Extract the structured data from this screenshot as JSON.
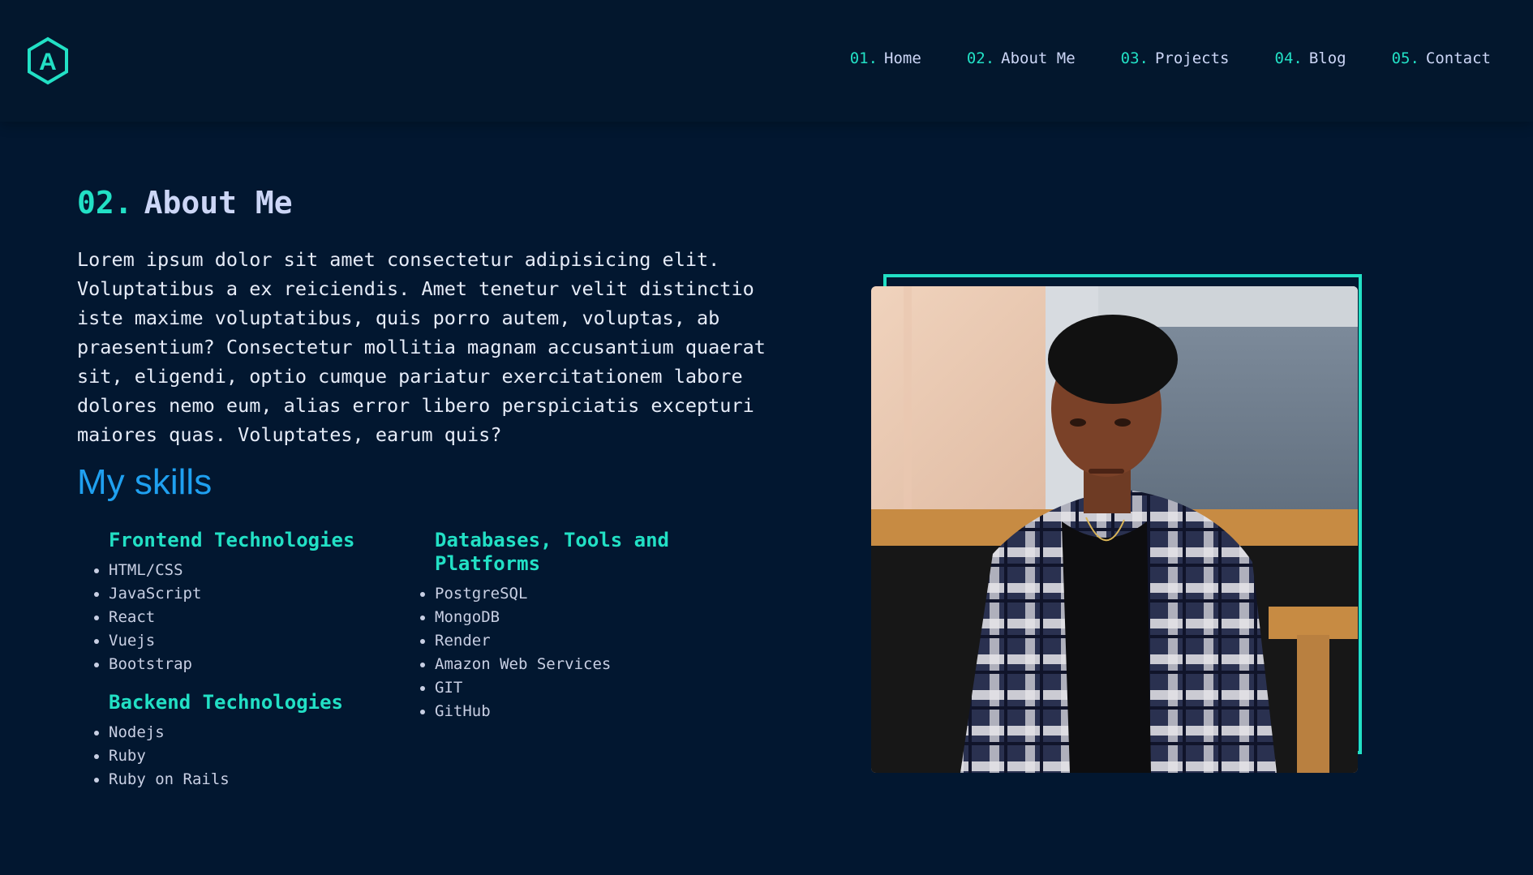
{
  "logo": {
    "letter": "A"
  },
  "nav": [
    {
      "num": "01.",
      "label": "Home"
    },
    {
      "num": "02.",
      "label": "About Me"
    },
    {
      "num": "03.",
      "label": "Projects"
    },
    {
      "num": "04.",
      "label": "Blog"
    },
    {
      "num": "05.",
      "label": "Contact"
    }
  ],
  "about": {
    "num": "02.",
    "title": "About Me",
    "intro": "Lorem ipsum dolor sit amet consectetur adipisicing elit. Voluptatibus a ex reiciendis. Amet tenetur velit distinctio iste maxime voluptatibus, quis porro autem, voluptas, ab praesentium? Consectetur mollitia magnam accusantium quaerat sit, eligendi, optio cumque pariatur exercitationem labore dolores nemo eum, alias error libero perspiciatis excepturi maiores quas. Voluptates, earum quis?"
  },
  "skills": {
    "title": "My skills",
    "frontend": {
      "heading": "Frontend Technologies",
      "items": [
        "HTML/CSS",
        "JavaScript",
        "React",
        "Vuejs",
        "Bootstrap"
      ]
    },
    "backend": {
      "heading": "Backend Technologies",
      "items": [
        "Nodejs",
        "Ruby",
        "Ruby on Rails"
      ]
    },
    "databases": {
      "heading": "Databases, Tools and Platforms",
      "items": [
        "PostgreSQL",
        "MongoDB",
        "Render",
        "Amazon Web Services",
        "GIT",
        "GitHub"
      ]
    }
  },
  "colors": {
    "background": "#021730",
    "accent": "#22e0c5",
    "skills_title": "#1fa0f0",
    "text": "#ccd6f6"
  }
}
